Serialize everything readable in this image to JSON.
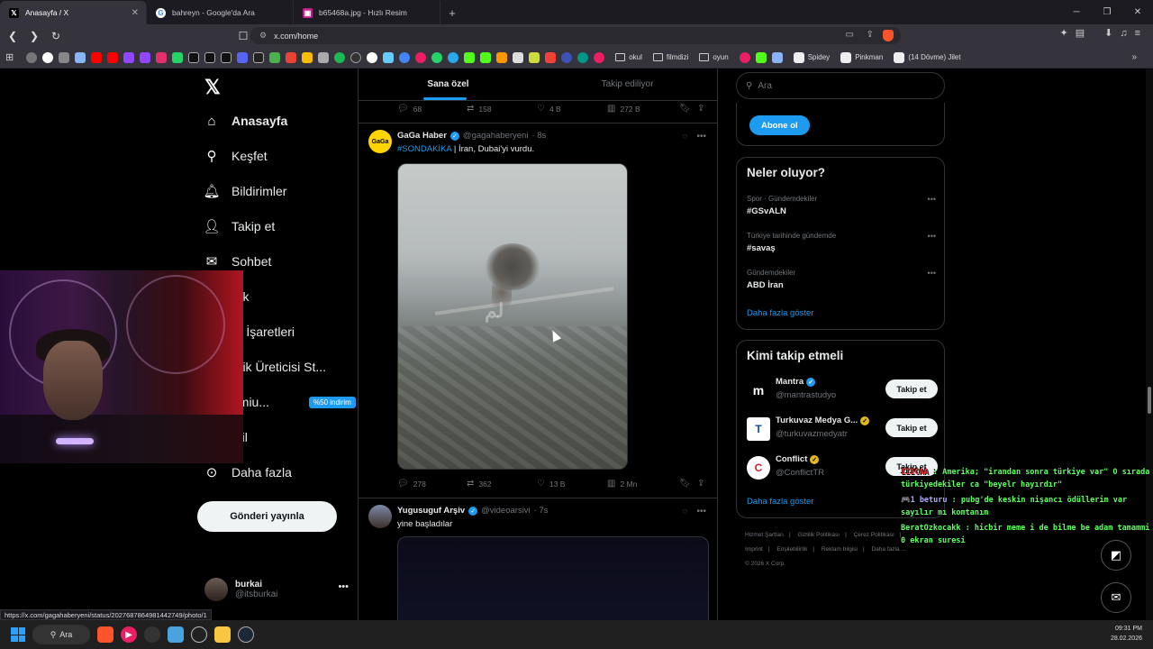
{
  "browser": {
    "tabs": [
      {
        "title": "Anasayfa / X",
        "favicon": "x-logo-icon",
        "active": true
      },
      {
        "title": "bahreyn - Google'da Ara",
        "favicon": "google-icon",
        "active": false
      },
      {
        "title": "b65468a.jpg - Hızlı Resim",
        "favicon": "image-icon",
        "active": false
      }
    ],
    "url": "x.com/home",
    "bookmark_folders": [
      "okul",
      "filmdizi",
      "oyun"
    ],
    "bookmark_links": [
      "Spidey",
      "Pinkman",
      "(14 Dövme) Jilet"
    ],
    "status_link": "https://x.com/gagahaberyeni/status/2027687864981442749/photo/1"
  },
  "nav": {
    "items": [
      {
        "label": "Anasayfa",
        "icon": "home-icon",
        "active": true
      },
      {
        "label": "Keşfet",
        "icon": "search-icon"
      },
      {
        "label": "Bildirimler",
        "icon": "bell-icon"
      },
      {
        "label": "Takip et",
        "icon": "add-user-icon"
      },
      {
        "label": "Sohbet",
        "icon": "mail-icon"
      },
      {
        "label": "rok",
        "icon": "grok-icon"
      },
      {
        "label": "er İşaretleri",
        "icon": "bookmark-icon"
      },
      {
        "label": "erik Üreticisi St...",
        "icon": "lightning-icon"
      },
      {
        "label": "emiu...",
        "icon": "x-icon"
      },
      {
        "label": "ofil",
        "icon": "profile-icon"
      },
      {
        "label": "Daha fazla",
        "icon": "more-circle-icon"
      }
    ],
    "premium_badge": "%50 indirim",
    "post_button": "Gönderi yayınla",
    "profile": {
      "name": "burkai",
      "handle": "@itsburkai"
    }
  },
  "feed": {
    "tabs": [
      "Sana özel",
      "Takip ediliyor"
    ],
    "top_actions": {
      "replies": "68",
      "reposts": "158",
      "likes": "4 B",
      "views": "272 B"
    },
    "posts": [
      {
        "name": "GaGa Haber",
        "handle": "@gagahaberyeni",
        "time": "· 8s",
        "hashtag": "#SONDAKİKA",
        "text": " | İran, Dubai'yi vurdu.",
        "avatar_text": "GaGa",
        "image_watermark": "ﻟﻢ",
        "actions": {
          "replies": "278",
          "reposts": "362",
          "likes": "13 B",
          "views": "2 Mn"
        }
      },
      {
        "name": "Yugusuguf Arşiv",
        "handle": "@videoarsivi",
        "time": "· 7s",
        "text": "yine başladılar"
      }
    ]
  },
  "sidebar": {
    "search_placeholder": "Ara",
    "subscribe_button": "Abone ol",
    "trends_title": "Neler oluyor?",
    "trends": [
      {
        "context": "Spor · Gündemdekiler",
        "name": "#GSvALN"
      },
      {
        "context": "Türkiye tarihinde gündemde",
        "name": "#savaş"
      },
      {
        "context": "Gündemdekiler",
        "name": "ABD İran"
      }
    ],
    "trends_more": "Daha fazla göster",
    "who_title": "Kimi takip etmeli",
    "who": [
      {
        "name": "Mantra",
        "handle": "@mantrastudyo",
        "badge": "blue",
        "avatar_text": "m"
      },
      {
        "name": "Turkuvaz Medya G...",
        "handle": "@turkuvazmedyatr",
        "badge": "gold",
        "avatar_text": "T"
      },
      {
        "name": "Conflict",
        "handle": "@ConflictTR",
        "badge": "gold",
        "avatar_text": "C"
      }
    ],
    "follow_label": "Takip et",
    "who_more": "Daha fazla göster",
    "footer": [
      "Hizmet Şartları",
      "|",
      "Gizlilik Politikası",
      "|",
      "Çerez Politikası",
      "|",
      "Imprint",
      "|",
      "Erişilebilirlik",
      "|",
      "Reklam bilgisi",
      "|",
      "Daha fazla ...",
      "© 2026 X Corp."
    ]
  },
  "chat": [
    {
      "user": "IIICAA",
      "text": ": Amerika; \"irandan sonra türkiye var\" O sırada türkiyedekiler ca \"beyelr hayırdır\""
    },
    {
      "user": "🎮1 beturu",
      "text": ": pubg'de keskin nişancı ödüllerim var sayılır mı komtanım"
    },
    {
      "user": "BeratOzkocakk",
      "text": ": hicbir meme i de bilme be adam tamammi 0 ekran suresi"
    }
  ],
  "taskbar": {
    "search": "Ara",
    "time": "09:31 PM",
    "date": "28.02.2026"
  },
  "colors": {
    "accent": "#1d9bf0",
    "background": "#000000",
    "border": "#2f3336",
    "muted": "#71767b"
  }
}
